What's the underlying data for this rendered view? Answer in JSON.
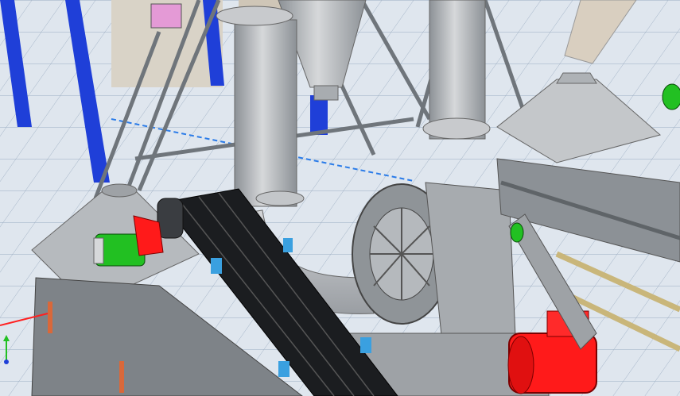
{
  "scene": {
    "kind": "3d-cad-viewport",
    "background_color": "#dfe6ee",
    "grid_color": "#9fb0c4",
    "colors": {
      "frame_blue": "#1f3fd8",
      "steel_gray": "#b9bcc0",
      "steel_dark": "#7e8388",
      "belt_black": "#1b1d20",
      "motor_red": "#ff1a1a",
      "motor_green": "#22c022",
      "bracket_blue": "#3aa0e0",
      "accent_orange": "#d9683a",
      "rail_tan": "#c9b67a"
    }
  },
  "components": [
    {
      "id": "cyclone",
      "name": "cyclone-separator"
    },
    {
      "id": "fan",
      "name": "centrifugal-fan"
    },
    {
      "id": "conveyor",
      "name": "belt-conveyor"
    },
    {
      "id": "hood-left",
      "name": "collection-hood-left"
    },
    {
      "id": "hood-right",
      "name": "collection-hood-right"
    },
    {
      "id": "motor-red",
      "name": "red-motor"
    },
    {
      "id": "motor-green",
      "name": "green-gear-motor"
    }
  ]
}
